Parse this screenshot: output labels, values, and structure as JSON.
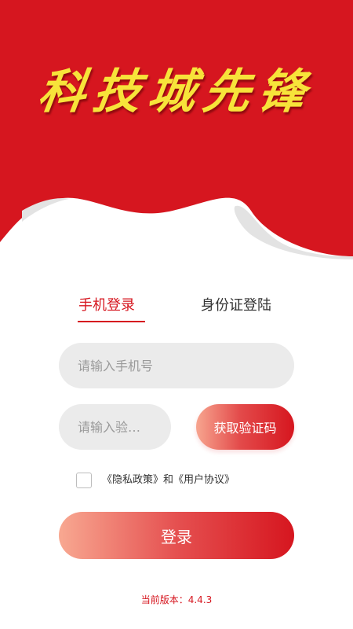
{
  "colors": {
    "brand_red": "#d6161f",
    "title_yellow": "#f7e33a",
    "input_bg": "#ebebeb",
    "wave_gray": "#e3e3e3"
  },
  "header": {
    "logo_title": "科技城先锋"
  },
  "tabs": [
    {
      "label": "手机登录",
      "active": true
    },
    {
      "label": "身份证登陆",
      "active": false
    }
  ],
  "form": {
    "phone_placeholder": "请输入手机号",
    "code_placeholder": "请输入验证码",
    "get_code_label": "获取验证码"
  },
  "agreement": {
    "checked": false,
    "privacy_link": "《隐私政策》",
    "and_text": "和",
    "user_link": "《用户协议》"
  },
  "login_label": "登录",
  "version": {
    "label": "当前版本：",
    "number": "4.4.3"
  }
}
